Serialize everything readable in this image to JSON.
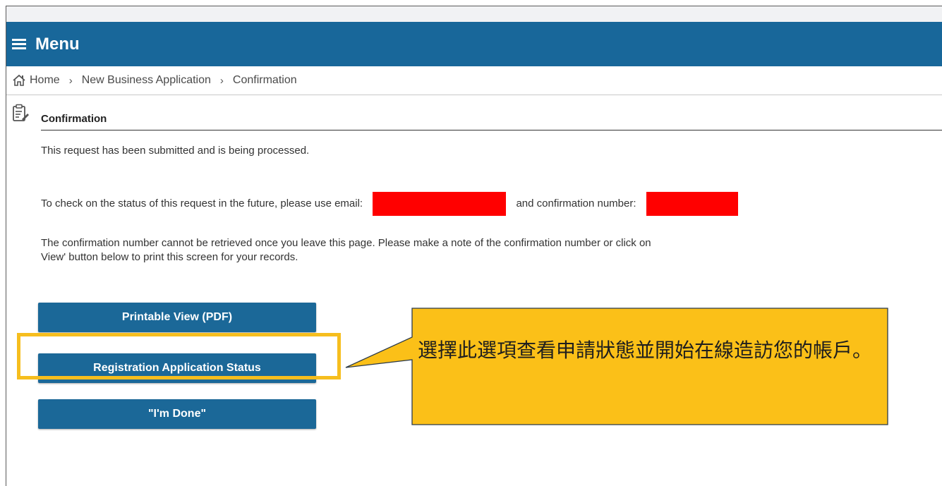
{
  "menu": {
    "label": "Menu"
  },
  "breadcrumb": {
    "separator": "›",
    "items": [
      "Home",
      "New Business Application",
      "Confirmation"
    ]
  },
  "section": {
    "title": "Confirmation"
  },
  "messages": {
    "submitted": "This request has been submitted and is being processed.",
    "status_prefix": "To check on the status of this request in the future, please use email:",
    "status_middle": "and confirmation number:",
    "note_line1": "The confirmation number cannot be retrieved once you leave this page. Please make a note of the confirmation number or click on",
    "note_line2": "View' button below to print this screen for your records."
  },
  "buttons": {
    "printable": "Printable View (PDF)",
    "status": "Registration Application Status",
    "done": "\"I'm Done\""
  },
  "callout": {
    "text": "選擇此選項查看申請狀態並開始在線造訪您的帳戶。"
  },
  "colors": {
    "menu_bar": "#18679a",
    "button": "#1b6898",
    "callout_fill": "#fbc018",
    "highlight_border": "#f6be1e",
    "redaction": "#ff0000"
  }
}
